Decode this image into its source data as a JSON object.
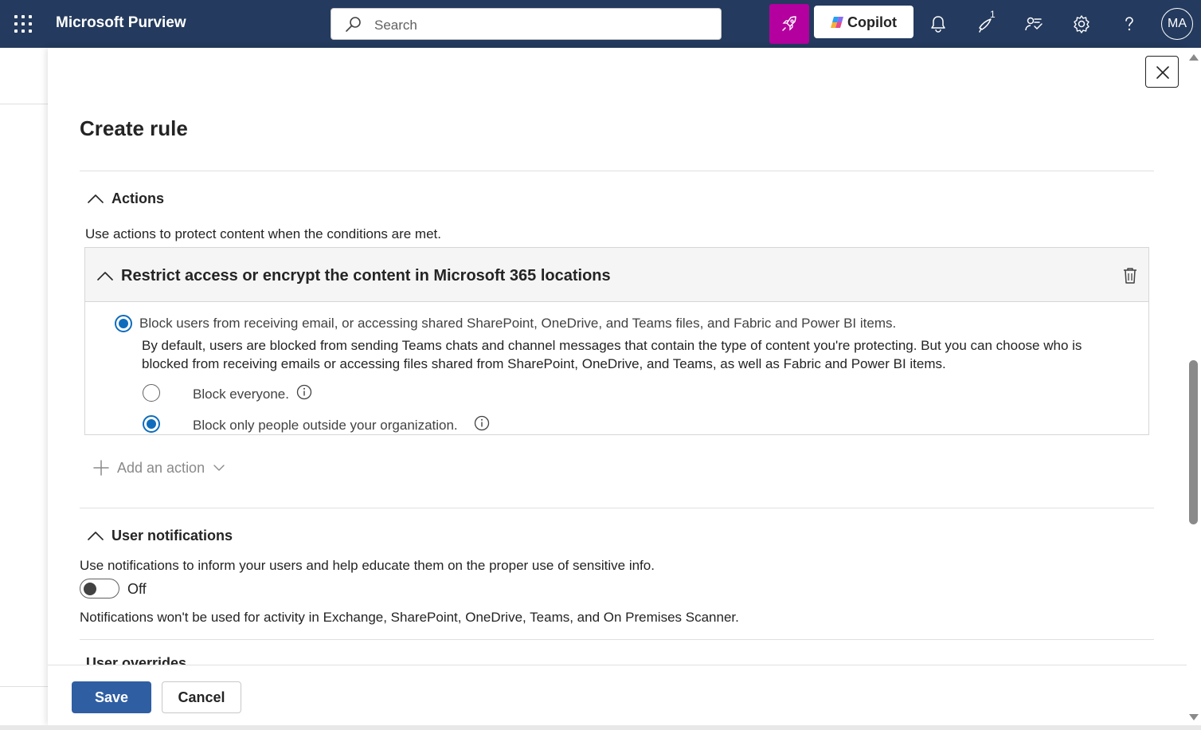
{
  "topbar": {
    "app_title": "Microsoft Purview",
    "search_placeholder": "Search",
    "copilot_label": "Copilot",
    "notification_badge": "1",
    "avatar_initials": "MA",
    "colors": {
      "bar": "#243a5e",
      "rocket": "#b4009e"
    }
  },
  "panel": {
    "title": "Create rule",
    "actions_section": {
      "heading": "Actions",
      "description": "Use actions to protect content when the conditions are met.",
      "card": {
        "title": "Restrict access or encrypt the content in Microsoft 365 locations",
        "main_option": "Block users from receiving email, or accessing shared SharePoint, OneDrive, and Teams files, and Fabric and Power BI items.",
        "help_line1": "By default, users are blocked from sending Teams chats and channel messages that contain the type of content you're protecting. But you can choose who is",
        "help_line2": "blocked from receiving emails or accessing files shared from SharePoint, OneDrive, and Teams, as well as Fabric and Power BI items.",
        "sub_options": [
          {
            "label": "Block everyone.",
            "checked": false
          },
          {
            "label": "Block only people outside your organization.",
            "checked": true
          }
        ]
      },
      "add_action_label": "Add an action"
    },
    "notifications_section": {
      "heading": "User notifications",
      "description": "Use notifications to inform your users and help educate them on the proper use of sensitive info.",
      "toggle_label": "Off",
      "note": "Notifications won't be used for activity in Exchange, SharePoint, OneDrive, Teams, and On Premises Scanner."
    },
    "next_section_heading": "User overrides"
  },
  "footer": {
    "save_label": "Save",
    "cancel_label": "Cancel"
  }
}
